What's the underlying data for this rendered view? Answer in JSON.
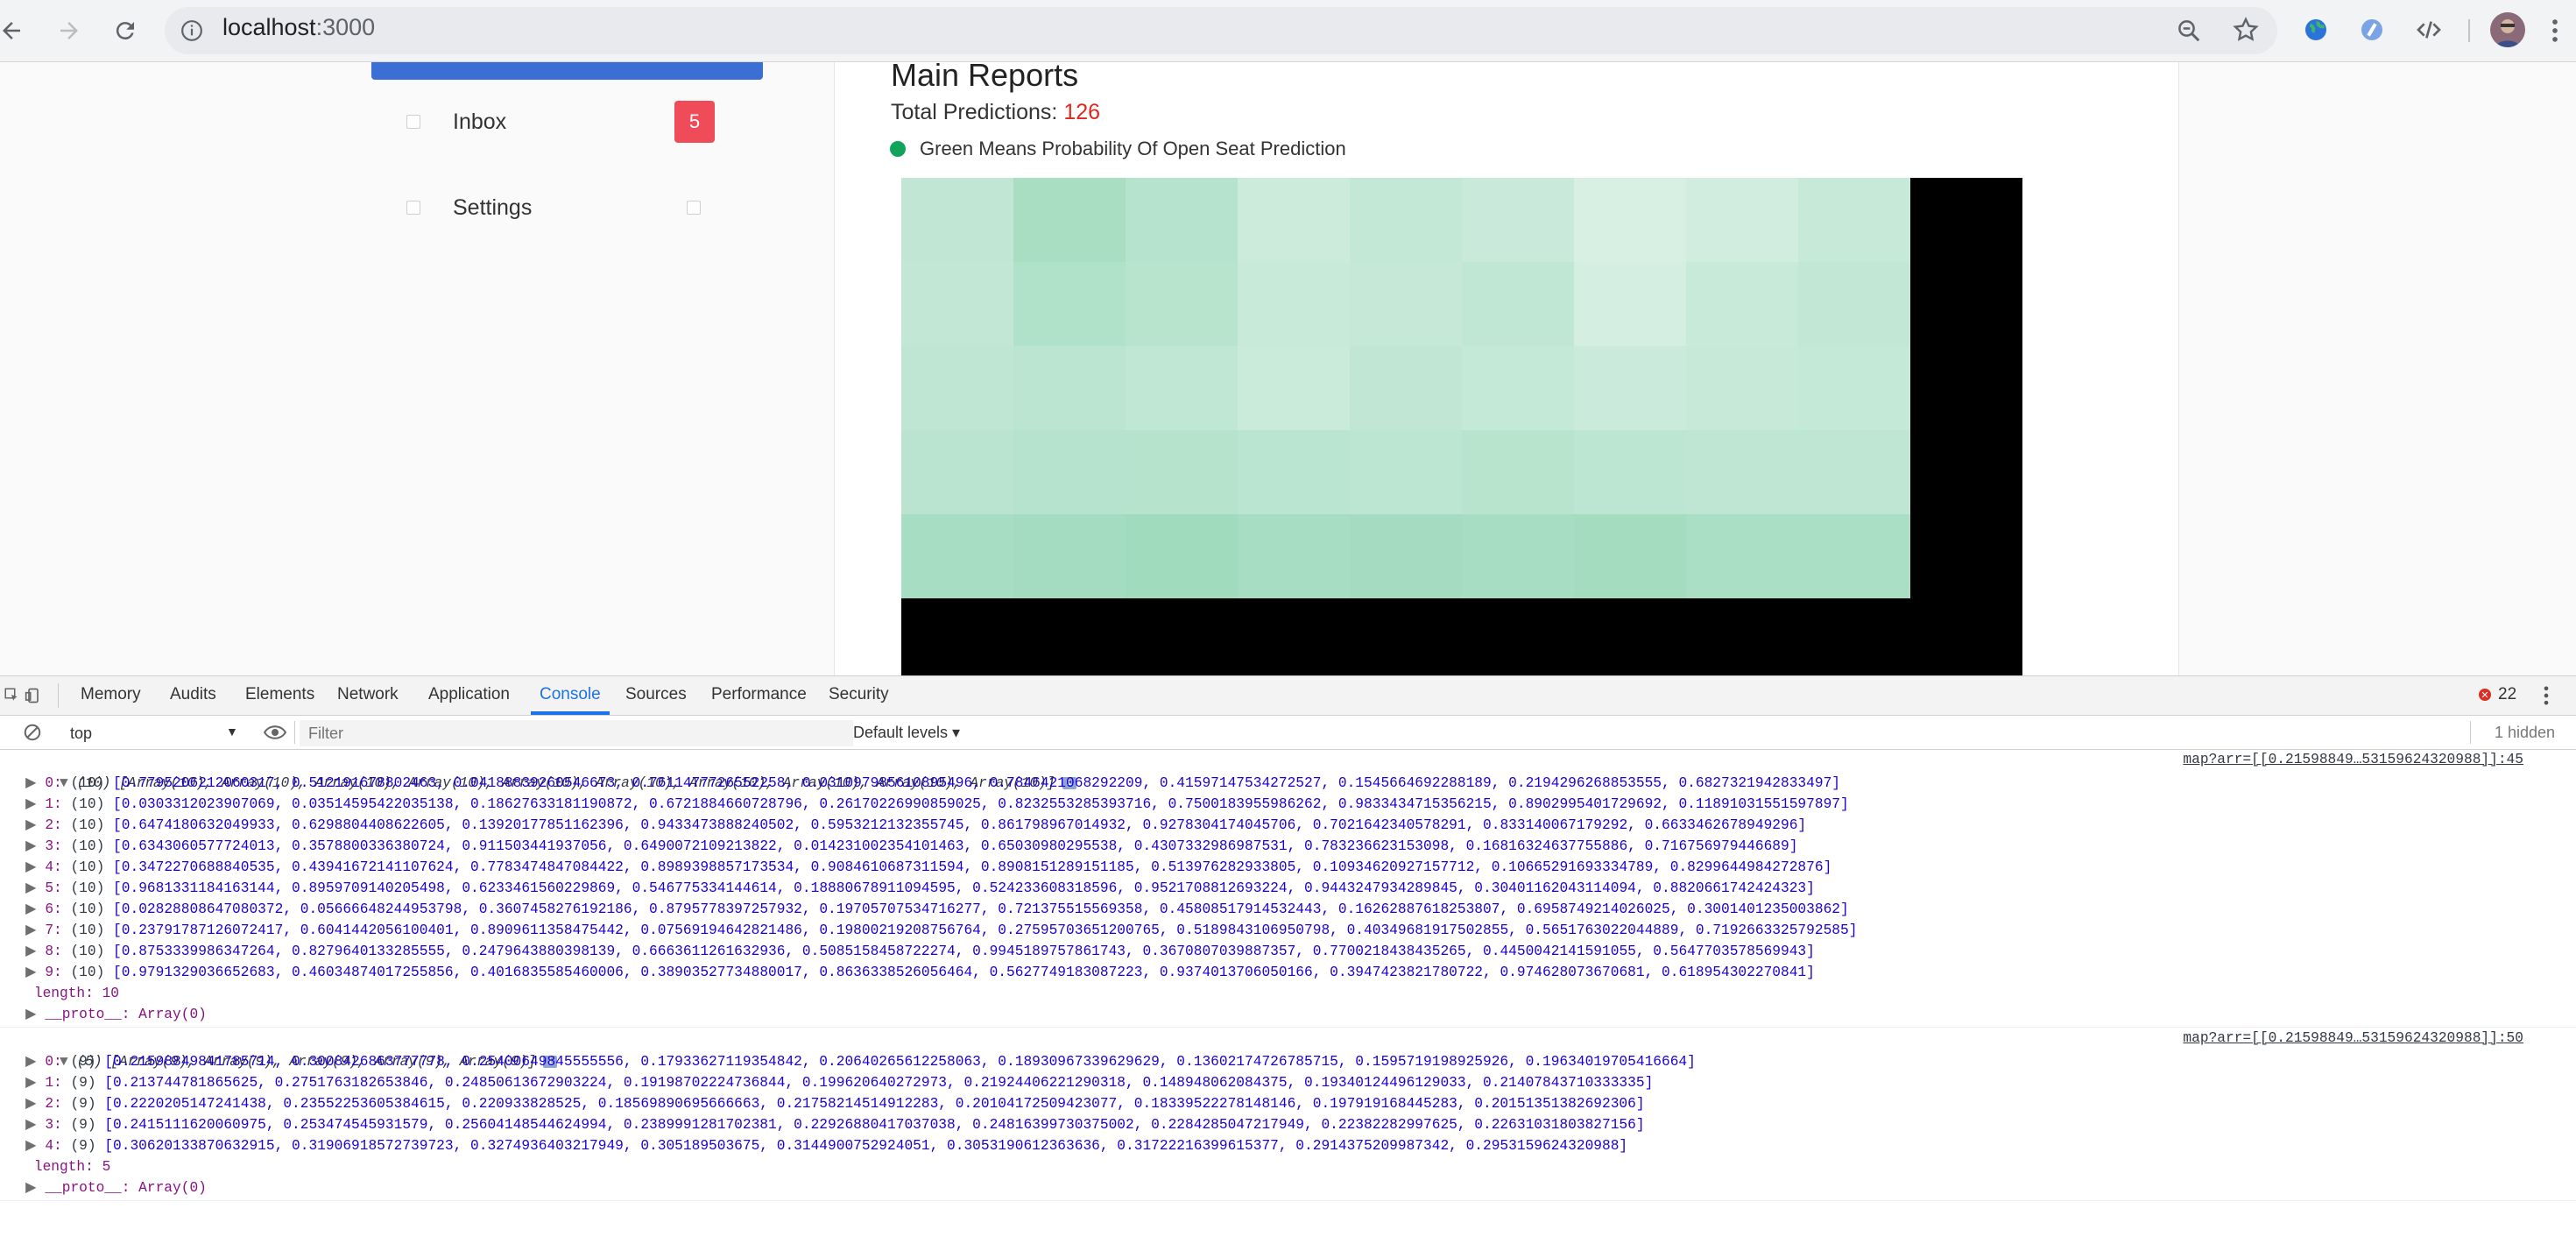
{
  "browser": {
    "url_host": "localhost",
    "url_port": ":3000"
  },
  "sidebar": {
    "items": [
      {
        "label": "Inbox",
        "badge": "5"
      },
      {
        "label": "Settings"
      }
    ]
  },
  "main": {
    "title": "Main Reports",
    "total_label": "Total Predictions: ",
    "total_value": "126",
    "legend": "Green Means Probability Of Open Seat Prediction"
  },
  "heatmap": {
    "colors": {
      "base": "#ffffff",
      "green": "#10a35a"
    },
    "rows": [
      [
        0.215988,
        0.300843,
        0.254006,
        0.179336,
        0.206402,
        0.18931,
        0.136022,
        0.159572,
        0.19634
      ],
      [
        0.213745,
        0.275176,
        0.248506,
        0.191988,
        0.199621,
        0.219244,
        0.148948,
        0.193401,
        0.214078
      ],
      [
        0.22202,
        0.235522,
        0.220934,
        0.185699,
        0.217582,
        0.201041,
        0.183395,
        0.197919,
        0.201514
      ],
      [
        0.241511,
        0.253475,
        0.256041,
        0.238999,
        0.229269,
        0.248164,
        0.228428,
        0.223823,
        0.22631
      ],
      [
        0.306201,
        0.31907,
        0.327494,
        0.30519,
        0.31449,
        0.305319,
        0.317223,
        0.291438,
        0.295316
      ]
    ]
  },
  "devtools": {
    "tabs": [
      "Memory",
      "Audits",
      "Elements",
      "Network",
      "Application",
      "Console",
      "Sources",
      "Performance",
      "Security"
    ],
    "active_tab": "Console",
    "error_count": "22",
    "context": "top",
    "filter_placeholder": "Filter",
    "levels": "Default levels ▾",
    "hidden": "1 hidden",
    "log1": {
      "header": "(10) [Array(10), Array(10), Array(10), Array(10), Array(10), Array(10), Array(10), Array(10), Array(10), Array(10)]",
      "source": "map?arr=[[0.21598849…53159624320988]]:45",
      "rows": [
        "[0.7795206212060317, 0.512191678802463, 0.04188839260546673, 0.7611477726552258, 0.031097985610895496, 0.7846421068292209, 0.41597147534272527, 0.1545664692288189, 0.2194296268853555, 0.6827321942833497]",
        "[0.0303312023907069, 0.03514595422035138, 0.18627633181190872, 0.6721884660728796, 0.26170226990859025, 0.8232553285393716, 0.7500183955986262, 0.9833434715356215, 0.8902995401729692, 0.11891031551597897]",
        "[0.6474180632049933, 0.6298804408622605, 0.13920177851162396, 0.9433473888240502, 0.5953212132355745, 0.861798967014932, 0.9278304174045706, 0.7021642340578291, 0.833140067179292, 0.6633462678949296]",
        "[0.6343060577724013, 0.3578800336380724, 0.911503441937056, 0.6490072109213822, 0.014231002354101463, 0.65030980295538, 0.4307332986987531, 0.783236623153098, 0.16816324637755886, 0.716756979446689]",
        "[0.3472270688840535, 0.43941672141107624, 0.7783474847084422, 0.8989398857173534, 0.9084610687311594, 0.8908151289151185, 0.513976282933805, 0.10934620927157712, 0.10665291693334789, 0.8299644984272876]",
        "[0.9681331184163144, 0.8959709140205498, 0.6233461560229869, 0.546775334144614, 0.18880678911094595, 0.524233608318596, 0.9521708812693224, 0.9443247934289845, 0.30401162043114094, 0.8820661742424323]",
        "[0.02828808647080372, 0.05666648244953798, 0.3607458276192186, 0.8795778397257932, 0.19705707534716277, 0.721375515569358, 0.45808517914532443, 0.16262887618253807, 0.6958749214026025, 0.3001401235003862]",
        "[0.23791787126072417, 0.6041442056100401, 0.8909611358475442, 0.07569194642821486, 0.19800219208756764, 0.27595703651200765, 0.5189843106950798, 0.40349681917502855, 0.5651763022044889, 0.7192663325792585]",
        "[0.8753339986347264, 0.8279640133285555, 0.2479643880398139, 0.6663611261632936, 0.5085158458722274, 0.9945189757861743, 0.3670807039887357, 0.7700218438435265, 0.4450042141591055, 0.5647703578569943]",
        "[0.9791329036652683, 0.46034874017255856, 0.4016835585460006, 0.38903527734880017, 0.8636338526056464, 0.5627749183087223, 0.9374013706050166, 0.3947423821780722, 0.974628073670681, 0.618954302270841]"
      ],
      "length": "length: 10",
      "proto": "__proto__: Array(0)"
    },
    "log2": {
      "header": "(5) [Array(9), Array(9), Array(9), Array(9), Array(9)]",
      "source": "map?arr=[[0.21598849…53159624320988]]:50",
      "rows": [
        "[0.21598849841785714, 0.3008426863777778, 0.25400649845555556, 0.17933627119354842, 0.20640265612258063, 0.18930967339629629, 0.13602174726785715, 0.1595719198925926, 0.19634019705416664]",
        "[0.213744781865625, 0.2751763182653846, 0.24850613672903224, 0.19198702224736844, 0.199620640272973, 0.21924406221290318, 0.148948062084375, 0.19340124496129033, 0.21407843710333335]",
        "[0.2220205147241438, 0.23552253605384615, 0.220933828525, 0.18569890695666663, 0.21758214514912283, 0.20104172509423077, 0.18339522278148146, 0.197919168445283, 0.20151351382692306]",
        "[0.2415111620060975, 0.253474545931579, 0.25604148544624994, 0.2389991281702381, 0.22926880417037038, 0.24816399730375002, 0.2284285047217949, 0.22382282997625, 0.22631031803827156]",
        "[0.30620133870632915, 0.31906918572739723, 0.3274936403217949, 0.305189503675, 0.3144900752924051, 0.3053190612363636, 0.31722216399615377, 0.2914375209987342, 0.2953159624320988]"
      ],
      "length": "length: 5",
      "proto": "__proto__: Array(0)"
    }
  }
}
